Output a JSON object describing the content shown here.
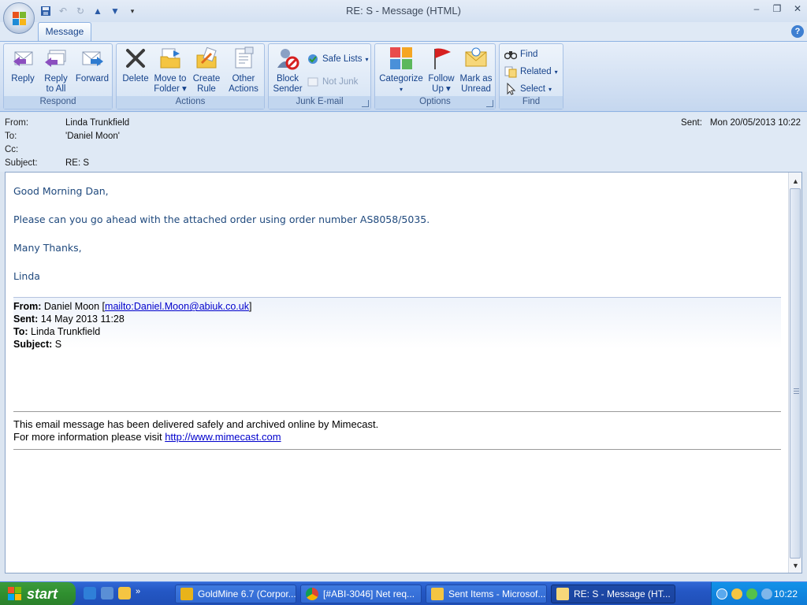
{
  "window": {
    "title": "RE: S  -  Message (HTML)"
  },
  "ribbon": {
    "tab": "Message",
    "groups": {
      "respond": {
        "title": "Respond",
        "reply": "Reply",
        "reply_all_1": "Reply",
        "reply_all_2": "to All",
        "forward": "Forward"
      },
      "actions": {
        "title": "Actions",
        "delete": "Delete",
        "move_1": "Move to",
        "move_2": "Folder",
        "create_1": "Create",
        "create_2": "Rule",
        "other_1": "Other",
        "other_2": "Actions"
      },
      "junk": {
        "title": "Junk E-mail",
        "block_1": "Block",
        "block_2": "Sender",
        "safe_lists": "Safe Lists",
        "not_junk": "Not Junk"
      },
      "options": {
        "title": "Options",
        "categorize": "Categorize",
        "follow_1": "Follow",
        "follow_2": "Up",
        "mark_1": "Mark as",
        "mark_2": "Unread"
      },
      "find": {
        "title": "Find",
        "find": "Find",
        "related": "Related",
        "select": "Select"
      }
    }
  },
  "header": {
    "from_label": "From:",
    "from_value": "Linda Trunkfield",
    "to_label": "To:",
    "to_value": "'Daniel Moon'",
    "cc_label": "Cc:",
    "cc_value": "",
    "subject_label": "Subject:",
    "subject_value": "RE: S",
    "sent_label": "Sent:",
    "sent_value": "Mon 20/05/2013 10:22"
  },
  "body": {
    "greeting": "Good Morning Dan,",
    "line1": "Please can you go ahead with the attached order using order number AS8058/5035.",
    "thanks": "Many Thanks,",
    "signature": "Linda",
    "quoted": {
      "from_label": "From:",
      "from_name": " Daniel Moon [",
      "from_link": "mailto:Daniel.Moon@abiuk.co.uk",
      "from_close": "]",
      "sent_label": "Sent:",
      "sent_value": " 14 May 2013 11:28",
      "to_label": "To:",
      "to_value": " Linda Trunkfield",
      "subject_label": "Subject:",
      "subject_value": " S"
    },
    "mimecast_line1": "This email message has been delivered safely and archived online by Mimecast.",
    "mimecast_line2": "For more information please visit ",
    "mimecast_link": "http://www.mimecast.com"
  },
  "taskbar": {
    "start": "start",
    "buttons": [
      "GoldMine 6.7 (Corpor...",
      "[#ABI-3046] Net req...",
      "Sent Items - Microsof...",
      "RE: S - Message (HT..."
    ],
    "clock": "10:22"
  },
  "colors": {
    "ribbon_text": "#15428b",
    "body_text": "#1f497d",
    "link": "#0000cc",
    "taskbar": "#2457c4",
    "start_green": "#2f8f2f"
  }
}
